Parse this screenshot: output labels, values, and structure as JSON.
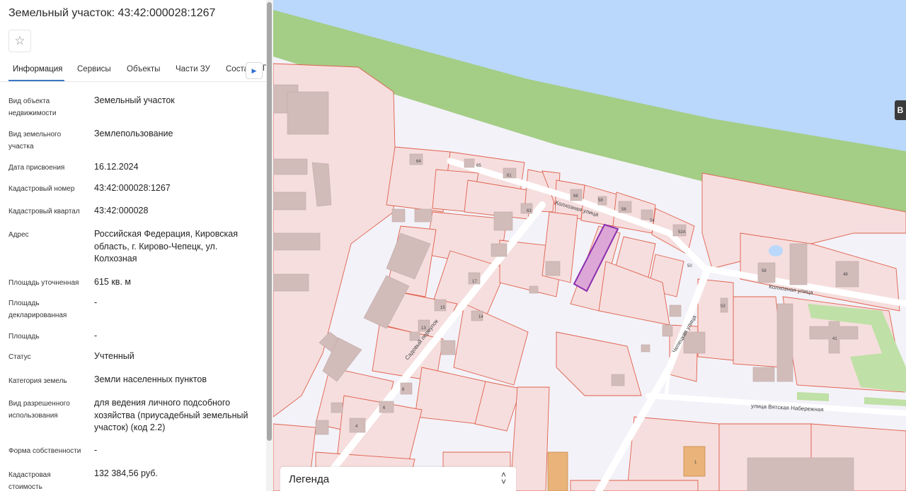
{
  "panel": {
    "title": "Земельный участок: 43:42:000028:1267",
    "favorite_icon": "star-outline-icon",
    "tabs": [
      {
        "label": "Информация",
        "active": true
      },
      {
        "label": "Сервисы",
        "active": false
      },
      {
        "label": "Объекты",
        "active": false
      },
      {
        "label": "Части ЗУ",
        "active": false
      },
      {
        "label": "Соста",
        "active": false
      }
    ],
    "tabs_overflow_glyph": "Г",
    "tabs_next_icon": "chevron-right-icon",
    "rows": [
      {
        "label": "Вид объекта недвижимости",
        "value": "Земельный участок"
      },
      {
        "label": "Вид земельного участка",
        "value": "Землепользование"
      },
      {
        "label": "Дата присвоения",
        "value": "16.12.2024"
      },
      {
        "label": "Кадастровый номер",
        "value": "43:42:000028:1267"
      },
      {
        "label": "Кадастровый квартал",
        "value": "43:42:000028"
      },
      {
        "label": "Адрес",
        "value": "Российская Федерация, Кировская область, г. Кирово-Чепецк, ул. Колхозная"
      },
      {
        "label": "Площадь уточненная",
        "value": "615 кв. м"
      },
      {
        "label": "Площадь декларированная",
        "value": "-"
      },
      {
        "label": "Площадь",
        "value": "-"
      },
      {
        "label": "Статус",
        "value": "Учтенный"
      },
      {
        "label": "Категория земель",
        "value": "Земли населенных пунктов"
      },
      {
        "label": "Вид разрешенного использования",
        "value": "для ведения личного подсобного хозяйства (приусадебный земельный участок) (код 2.2)"
      },
      {
        "label": "Форма собственности",
        "value": "-"
      },
      {
        "label": "Кадастровая стоимость",
        "value": "132 384,56 руб."
      }
    ]
  },
  "map": {
    "colors": {
      "water": "#b9d8fb",
      "riverbank": "#a4cd86",
      "background": "#f3f2f8",
      "parcel_fill": "#f6dede",
      "parcel_stroke": "#e0604c",
      "building": "#d2bcba",
      "selected_fill": "#dca7d6",
      "selected_stroke": "#8b2fb0",
      "road": "#ffffff",
      "green": "#bfe0a6",
      "orange_building": "#e9b37a"
    },
    "streets": [
      {
        "name": "Колхозная улица"
      },
      {
        "name": "Колхозная улица"
      },
      {
        "name": "Садовый переулок"
      },
      {
        "name": "Чепецкая улица"
      },
      {
        "name": "улица Вятская Набережная"
      }
    ],
    "house_numbers": [
      "64",
      "65",
      "61",
      "63",
      "68",
      "58",
      "56",
      "54",
      "52А",
      "50",
      "17",
      "15",
      "13",
      "14",
      "8",
      "6",
      "4",
      "58",
      "48",
      "53",
      "41",
      "1"
    ],
    "side_button_label": "В",
    "legend": {
      "label": "Легенда",
      "toggle_icon": "chevron-up-down-icon"
    }
  }
}
